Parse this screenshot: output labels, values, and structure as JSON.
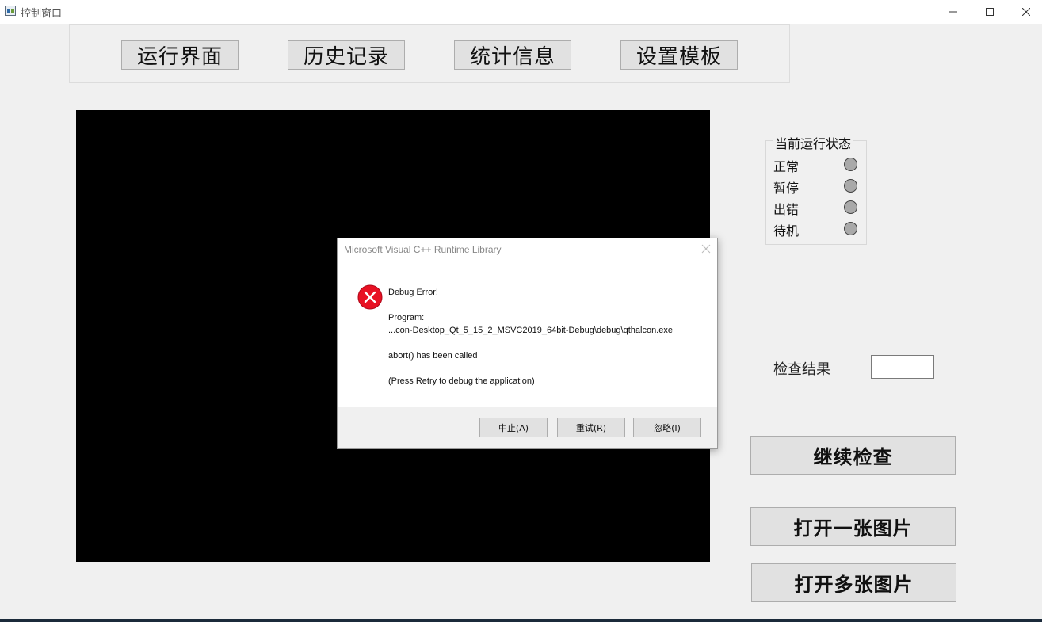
{
  "window": {
    "title": "控制窗口",
    "icons": {
      "app": "app-window-icon",
      "minimize": "minimize-icon",
      "maximize": "maximize-icon",
      "close": "close-icon"
    }
  },
  "tabs": [
    {
      "label": "运行界面"
    },
    {
      "label": "历史记录"
    },
    {
      "label": "统计信息"
    },
    {
      "label": "设置模板"
    }
  ],
  "status": {
    "title": "当前运行状态",
    "items": [
      {
        "label": "正常"
      },
      {
        "label": "暂停"
      },
      {
        "label": "出错"
      },
      {
        "label": "待机"
      }
    ],
    "led_color": "#a9a9a9"
  },
  "result": {
    "label": "检查结果",
    "value": ""
  },
  "actions": {
    "continue": "继续检查",
    "open_one": "打开一张图片",
    "open_many": "打开多张图片"
  },
  "dialog": {
    "title": "Microsoft Visual C++ Runtime Library",
    "icon": "error-icon",
    "lines": [
      "Debug Error!",
      "",
      "Program:",
      "...con-Desktop_Qt_5_15_2_MSVC2019_64bit-Debug\\debug\\qthalcon.exe",
      "",
      "abort() has been called",
      "",
      "(Press Retry to debug the application)"
    ],
    "buttons": {
      "abort": "中止(A)",
      "retry": "重试(R)",
      "ignore": "忽略(I)"
    },
    "error_color": "#e81123"
  }
}
